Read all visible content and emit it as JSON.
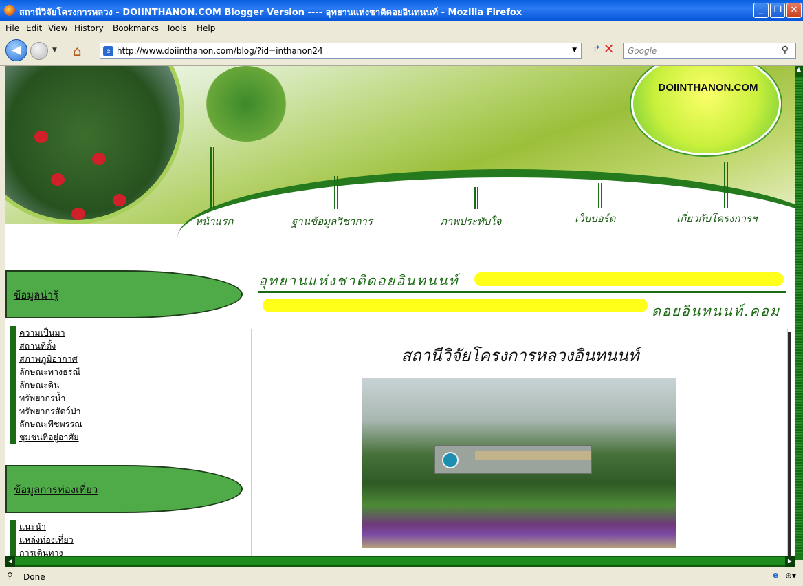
{
  "window": {
    "title": "สถานีวิจัยโครงการหลวง - DOIINTHANON.COM Blogger Version ---- อุทยานแห่งชาติดอยอินทนนท์ - Mozilla Firefox",
    "minimize_glyph": "_",
    "maximize_glyph": "❐",
    "close_glyph": "✕"
  },
  "menu": [
    "File",
    "Edit",
    "View",
    "History",
    "Bookmarks",
    "Tools",
    "Help"
  ],
  "nav": {
    "url": "http://www.doiinthanon.com/blog/?id=inthanon24",
    "search_placeholder": "Google"
  },
  "site": {
    "logo_text": "DOIINTHANON.COM",
    "nav_links": [
      "หน้าแรก",
      "ฐานข้อมูลวิชาการ",
      "ภาพประทับใจ",
      "เว็บบอร์ด",
      "เกี่ยวกับโครงการฯ"
    ],
    "name_th": "อุทยานแห่งชาติดอยอินทนนท์",
    "name_th_com": "ดอยอินทนนท์.คอม"
  },
  "sidebar": {
    "sections": [
      {
        "heading": "ข้อมูลน่ารู้",
        "items": [
          "ความเป็นมา",
          "สถานที่ตั้ง",
          "สภาพภูมิอากาศ",
          "ลักษณะทางธรณี",
          "ลักษณะดิน",
          "ทรัพยากรน้ำ",
          "ทรัพยากรสัตว์ป่า",
          "ลักษณะพืชพรรณ",
          "ชุมชนที่อยู่อาศัย"
        ]
      },
      {
        "heading": "ข้อมูลการท่องเที่ยว",
        "items": [
          "แนะนำ",
          "แหล่งท่องเที่ยว",
          "การเดินทาง"
        ]
      }
    ]
  },
  "article": {
    "title": "สถานีวิจัยโครงการหลวงอินทนนท์"
  },
  "status": {
    "text": "Done"
  },
  "colors": {
    "site_green": "#1b6a14",
    "sidebar_pill": "#4faa48",
    "yellow_bar": "#ffff1a",
    "xp_blue": "#0a5fe0"
  }
}
